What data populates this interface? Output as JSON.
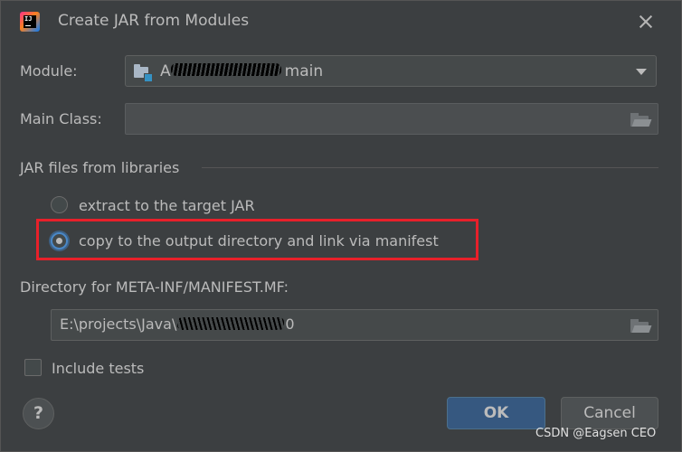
{
  "window": {
    "title": "Create JAR from Modules",
    "app_icon": "intellij-idea-icon",
    "close_icon": "close-icon"
  },
  "module": {
    "label": "Module:",
    "value_prefix": "A",
    "value_suffix": "main",
    "icon": "module-folder-icon",
    "dropdown_icon": "chevron-down-icon"
  },
  "main_class": {
    "label": "Main Class:",
    "value": "",
    "browse_icon": "folder-open-icon"
  },
  "jar_libraries": {
    "group_label": "JAR files from libraries",
    "options": [
      {
        "label": "extract to the target JAR",
        "selected": false
      },
      {
        "label": "copy to the output directory and link via manifest",
        "selected": true
      }
    ],
    "highlight_color": "#e8202a"
  },
  "manifest_dir": {
    "label": "Directory for META-INF/MANIFEST.MF:",
    "value_prefix": "E:\\projects\\Java\\",
    "value_suffix": "0",
    "browse_icon": "folder-open-icon"
  },
  "include_tests": {
    "label": "Include tests",
    "checked": false
  },
  "footer": {
    "help_label": "?",
    "ok_label": "OK",
    "cancel_label": "Cancel"
  },
  "watermark": "CSDN @Eagsen CEO",
  "colors": {
    "background": "#3c3f41",
    "text": "#bbbbbb",
    "ok_button": "#365880",
    "selection_ring": "#4a88c7"
  }
}
